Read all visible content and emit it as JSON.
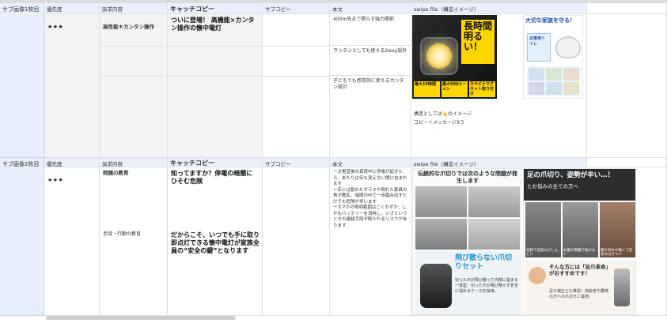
{
  "sheet": {
    "row1": {
      "label": "サブ画像1枚目",
      "headers": {
        "priority": "優先度",
        "appeal": "訴求内容",
        "catch": "キャッチコピー",
        "sub": "サブコピー",
        "body": "本文",
        "swipe": "swipe file（構造イメージ）"
      },
      "priority": "★★★",
      "appeal": "高性能＊カンタン操作",
      "catch": "ついに登場！ 高機能×カンタン操作の懐中電灯",
      "body_lines": [
        "400m先まで照らす強力照射",
        "ランタンとしても使える2way設計",
        "子どもでも感覚的に使えるカンタン設計"
      ],
      "image1": {
        "headline": "長時間明るい！",
        "badges": [
          "最大15時間",
          "最大500ルーメン",
          "カラビナマグネット取り付け"
        ]
      },
      "image2": {
        "headline": "大切な家族を守る！",
        "sub": "災害用トイレ"
      },
      "note_lines": [
        "構造としては👆のイメージ",
        "コピー＋メッセージ3つ"
      ]
    },
    "row2": {
      "label": "サブ画像2枚目",
      "headers": {
        "priority": "優先度",
        "appeal": "訴求内容",
        "catch": "キャッチコピー",
        "sub": "サブコピー",
        "body": "本文",
        "swipe": "swipe file（構造イメージ）"
      },
      "priority": "★★★",
      "appeal1": "問題の教育",
      "appeal2": "手段・行動の教育",
      "catch1": "知ってますか？停電の暗闇にひそむ危険",
      "catch2": "だからこそ、いつでも手に取り即点灯できる懐中電灯が家族全員の“安全の鍵”となります",
      "body": "ー災害直後の真夜中に停電が起きたら、あたりは何も見えない闇に包まれます\nー床には割れたガラスや倒れた家具の角が散乱、暗闇の中で一歩踏み出すだけでも危険が伴います\nースマホの照明範囲はごくわずか、しかもバッテリーを消耗し、いざというときの連絡手段が断たれるリスクがあります",
      "image1": {
        "headline": "伝統的な爪切りでは次のような問題が発生します",
        "product": "飛び散らない爪切りセット",
        "caption": "切った爪が飛び散って内部に溜まる一体型。切った爪が飛び散らず安全に溜めるケースを採用。"
      },
      "image2": {
        "headline": "足の爪切り、姿勢が辛い…！",
        "sub": "とお悩みの全ての方へ",
        "labels": [
          "高齢で前屈みがしんどい",
          "お腹が邪魔で届かない",
          "腰や背中が痛くて前屈みはきつい"
        ],
        "bottom_head": "そんな方には「足爪革命」がおすすめです！",
        "bottom_sub": "足爪補正士も推奨！高齢者や腰痛の方への爪切りに最適。"
      }
    }
  },
  "colors": {
    "header_bg": "#e9effb",
    "row_label_bg": "#e8eefc",
    "grid": "#e0e0e0"
  }
}
